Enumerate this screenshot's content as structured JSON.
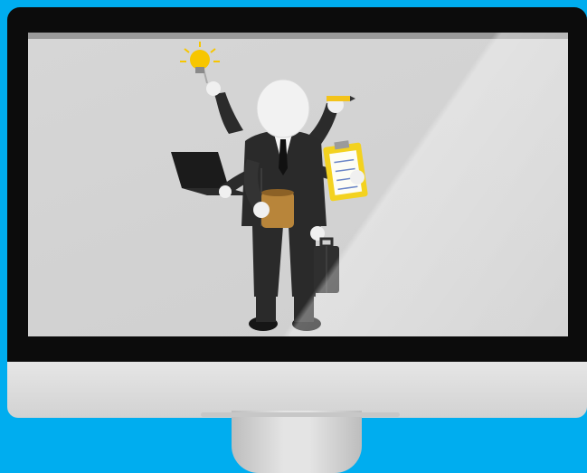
{
  "image": {
    "description_type": "illustration",
    "subject": "multitasking-businessman-on-desktop-monitor",
    "icons": [
      "lightbulb-icon",
      "laptop-icon",
      "coffee-mug-icon",
      "clipboard-icon",
      "pencil-icon",
      "briefcase-icon"
    ]
  },
  "colors": {
    "background": "#00adef",
    "bezel": "#0c0c0c",
    "chin": "#dcdcdc",
    "screen": "#d4d4d4",
    "suit": "#2a2a2a",
    "head": "#f2f2f2",
    "mug": "#b8853a",
    "clipboard": "#f3d21f",
    "bulb": "#f7c600"
  }
}
